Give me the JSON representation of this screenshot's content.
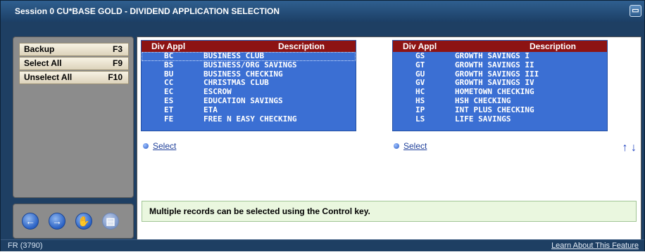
{
  "window": {
    "title": "Session 0 CU*BASE GOLD - DIVIDEND APPLICATION SELECTION",
    "icon": "window-menu-icon"
  },
  "sidebar": {
    "buttons": [
      {
        "label": "Backup",
        "key": "F3"
      },
      {
        "label": "Select All",
        "key": "F9"
      },
      {
        "label": "Unselect All",
        "key": "F10"
      }
    ],
    "nav": [
      {
        "icon": "back-arrow-icon"
      },
      {
        "icon": "forward-arrow-icon"
      },
      {
        "icon": "hand-icon"
      },
      {
        "icon": "print-icon"
      }
    ]
  },
  "grid_left": {
    "headers": {
      "code": "Div Appl",
      "desc": "Description"
    },
    "rows": [
      {
        "code": "BC",
        "desc": "BUSINESS CLUB"
      },
      {
        "code": "BS",
        "desc": "BUSINESS/ORG SAVINGS"
      },
      {
        "code": "BU",
        "desc": "BUSINESS CHECKING"
      },
      {
        "code": "CC",
        "desc": "CHRISTMAS CLUB"
      },
      {
        "code": "EC",
        "desc": "ESCROW"
      },
      {
        "code": "ES",
        "desc": "EDUCATION SAVINGS"
      },
      {
        "code": "ET",
        "desc": "ETA"
      },
      {
        "code": "FE",
        "desc": "FREE N EASY CHECKING"
      }
    ],
    "select_label": "Select"
  },
  "grid_right": {
    "headers": {
      "code": "Div Appl",
      "desc": "Description"
    },
    "rows": [
      {
        "code": "GS",
        "desc": "GROWTH SAVINGS I"
      },
      {
        "code": "GT",
        "desc": "GROWTH SAVINGS II"
      },
      {
        "code": "GU",
        "desc": "GROWTH SAVINGS III"
      },
      {
        "code": "GV",
        "desc": "GROWTH SAVINGS IV"
      },
      {
        "code": "HC",
        "desc": "HOMETOWN CHECKING"
      },
      {
        "code": "HS",
        "desc": "HSH CHECKING"
      },
      {
        "code": "IP",
        "desc": "INT PLUS CHECKING"
      },
      {
        "code": "LS",
        "desc": "LIFE SAVINGS"
      }
    ],
    "select_label": "Select"
  },
  "message": "Multiple records can be selected using the Control key.",
  "status": {
    "left": "FR (3790)",
    "link": "Learn About This Feature"
  },
  "colors": {
    "header_red": "#8d1313",
    "grid_blue": "#3b6fd3",
    "frame": "#1e3f63"
  }
}
